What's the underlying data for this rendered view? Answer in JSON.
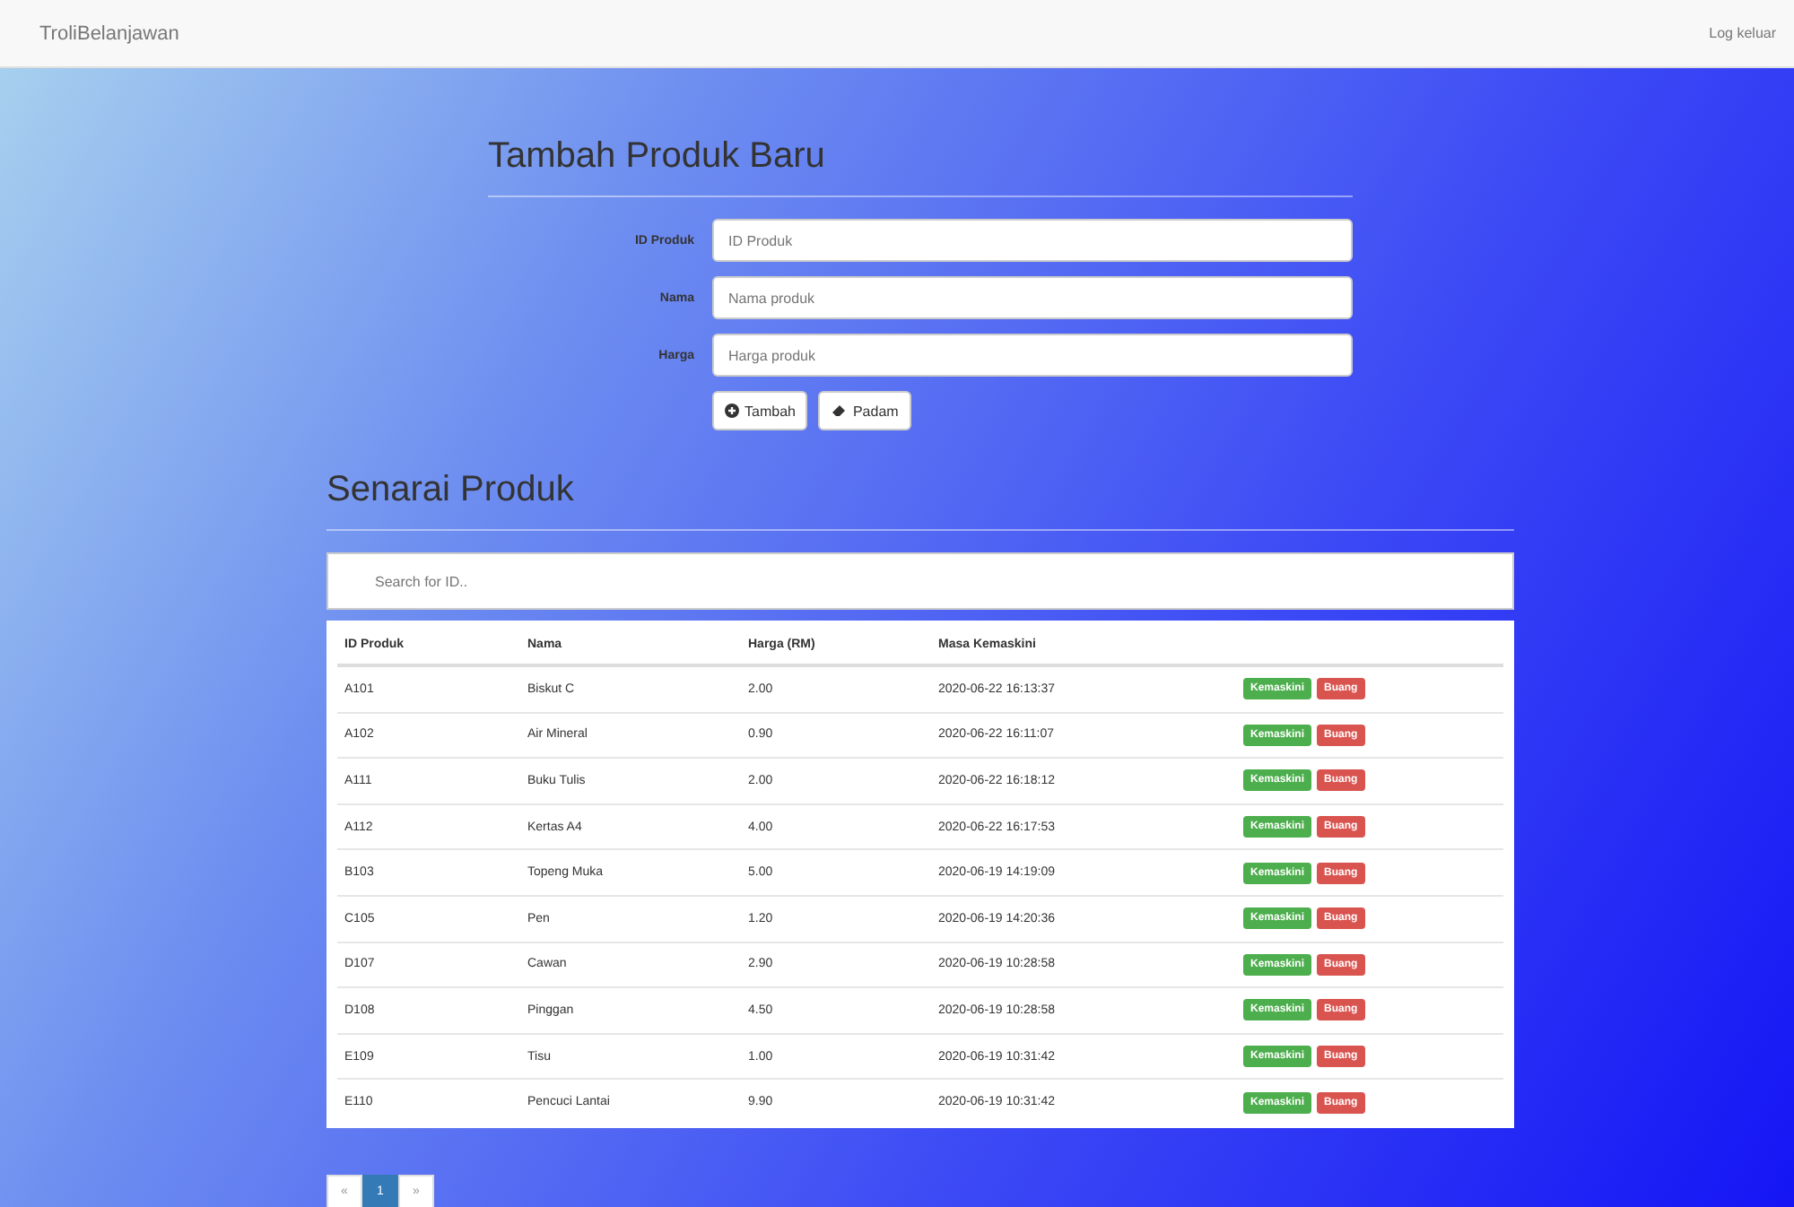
{
  "navbar": {
    "brand": "TroliBelanjawan",
    "logout": "Log keluar"
  },
  "form": {
    "title": "Tambah Produk Baru",
    "fields": [
      {
        "label": "ID Produk",
        "placeholder": "ID Produk"
      },
      {
        "label": "Nama",
        "placeholder": "Nama produk"
      },
      {
        "label": "Harga",
        "placeholder": "Harga produk"
      }
    ],
    "buttons": [
      {
        "kind": "add",
        "label": "Tambah"
      },
      {
        "kind": "clear",
        "label": "Padam"
      }
    ]
  },
  "list": {
    "title": "Senarai Produk",
    "search": {
      "placeholder": "Search for ID.."
    },
    "columns": [
      "ID Produk",
      "Nama",
      "Harga (RM)",
      "Masa Kemaskini"
    ],
    "rows": [
      {
        "cells": [
          "A101",
          "Biskut C",
          "2.00",
          "2020-06-22 16:13:37"
        ],
        "edit": "Kemaskini",
        "delete": "Buang"
      },
      {
        "cells": [
          "A102",
          "Air Mineral",
          "0.90",
          "2020-06-22 16:11:07"
        ],
        "edit": "Kemaskini",
        "delete": "Buang"
      },
      {
        "cells": [
          "A111",
          "Buku Tulis",
          "2.00",
          "2020-06-22 16:18:12"
        ],
        "edit": "Kemaskini",
        "delete": "Buang"
      },
      {
        "cells": [
          "A112",
          "Kertas A4",
          "4.00",
          "2020-06-22 16:17:53"
        ],
        "edit": "Kemaskini",
        "delete": "Buang"
      },
      {
        "cells": [
          "B103",
          "Topeng Muka",
          "5.00",
          "2020-06-19 14:19:09"
        ],
        "edit": "Kemaskini",
        "delete": "Buang"
      },
      {
        "cells": [
          "C105",
          "Pen",
          "1.20",
          "2020-06-19 14:20:36"
        ],
        "edit": "Kemaskini",
        "delete": "Buang"
      },
      {
        "cells": [
          "D107",
          "Cawan",
          "2.90",
          "2020-06-19 10:28:58"
        ],
        "edit": "Kemaskini",
        "delete": "Buang"
      },
      {
        "cells": [
          "D108",
          "Pinggan",
          "4.50",
          "2020-06-19 10:28:58"
        ],
        "edit": "Kemaskini",
        "delete": "Buang"
      },
      {
        "cells": [
          "E109",
          "Tisu",
          "1.00",
          "2020-06-19 10:31:42"
        ],
        "edit": "Kemaskini",
        "delete": "Buang"
      },
      {
        "cells": [
          "E110",
          "Pencuci Lantai",
          "9.90",
          "2020-06-19 10:31:42"
        ],
        "edit": "Kemaskini",
        "delete": "Buang"
      }
    ],
    "pagination": [
      {
        "label": "«",
        "selected": false
      },
      {
        "label": "1",
        "selected": true
      },
      {
        "label": "»",
        "selected": false
      }
    ]
  }
}
